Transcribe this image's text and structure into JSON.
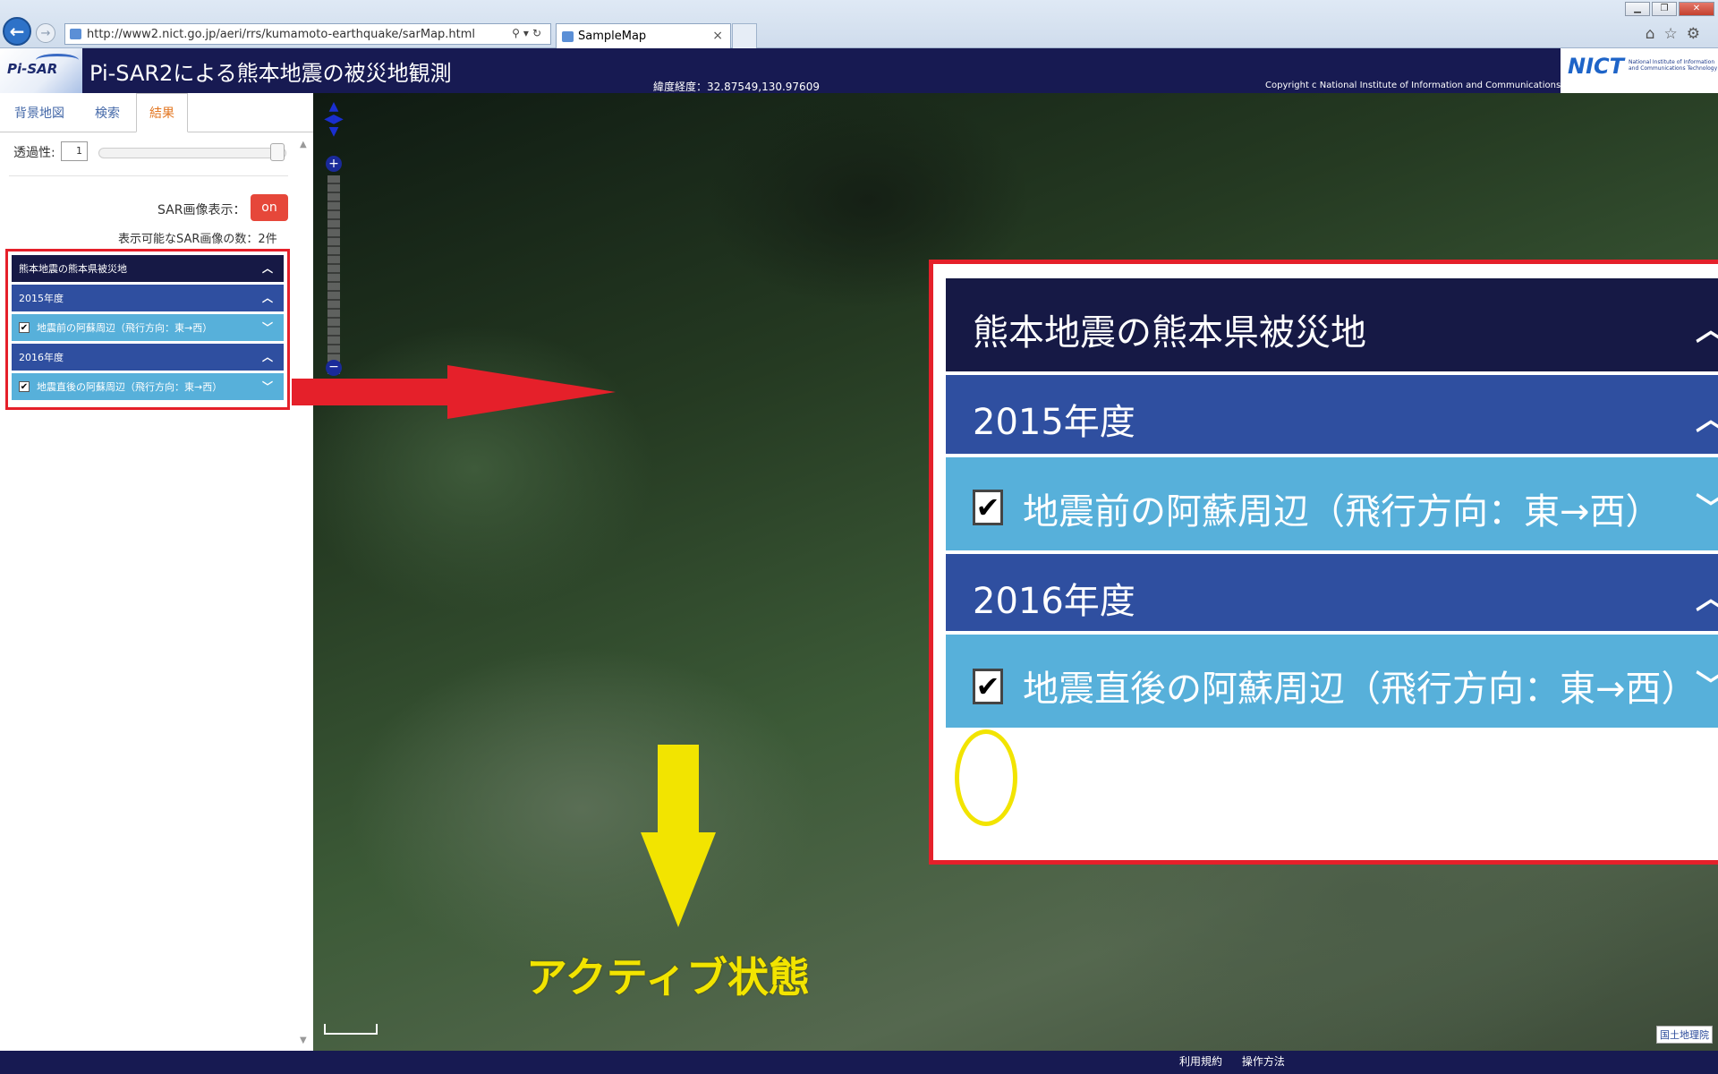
{
  "browser": {
    "url": "http://www2.nict.go.jp/aeri/rrs/kumamoto-earthquake/sarMap.html",
    "tab_title": "SampleMap",
    "tab_close": "×"
  },
  "header": {
    "logo_text": "Pi-SAR",
    "title": "Pi-SAR2による熊本地震の被災地観測",
    "coords": "緯度経度：32.87549,130.97609",
    "copyright": "Copyright c National Institute of Information and Communications Technology. All Rights Reserved.",
    "nict": "NICT",
    "nict_sub": "National Institute of Information and Communications Technology"
  },
  "panel": {
    "tabs": [
      "背景地図",
      "検索",
      "結果"
    ],
    "opacity_label": "透過性:",
    "opacity_value": "1",
    "sar_label": "SAR画像表示：",
    "sar_toggle": "on",
    "sar_count": "表示可能なSAR画像の数：2件",
    "layers": [
      {
        "label": "熊本地震の熊本県被災地",
        "chevron": "up",
        "level": "root"
      },
      {
        "label": "2015年度",
        "chevron": "up",
        "level": "year"
      },
      {
        "label": "地震前の阿蘇周辺（飛行方向：東→西）",
        "chevron": "down",
        "level": "item",
        "checked": true
      },
      {
        "label": "2016年度",
        "chevron": "up",
        "level": "year"
      },
      {
        "label": "地震直後の阿蘇周辺（飛行方向：東→西）",
        "chevron": "down",
        "level": "item",
        "checked": true
      }
    ]
  },
  "callout": {
    "root": "熊本地震の熊本県被災地",
    "year1": "2015年度",
    "item1": "地震前の阿蘇周辺（飛行方向：東→西）",
    "year2": "2016年度",
    "item2": "地震直後の阿蘇周辺（飛行方向：東→西）"
  },
  "annotation": "アクティブ状態",
  "map": {
    "attribution": "国土地理院"
  },
  "footer": {
    "terms": "利用規約",
    "howto": "操作方法"
  },
  "colors": {
    "header_bg": "#171a52",
    "root_bg": "#161945",
    "year_bg": "#2f4fa0",
    "item_bg": "#57b0da",
    "toggle_on": "#e6473a",
    "highlight_red": "#e5202a",
    "highlight_yellow": "#f2e400",
    "active_tab": "#e37722"
  },
  "icons": [
    "back-arrow-icon",
    "forward-arrow-icon",
    "search-icon",
    "refresh-icon",
    "home-icon",
    "star-icon",
    "gear-icon",
    "chevron-up-icon",
    "chevron-down-icon",
    "checkbox-icon"
  ]
}
